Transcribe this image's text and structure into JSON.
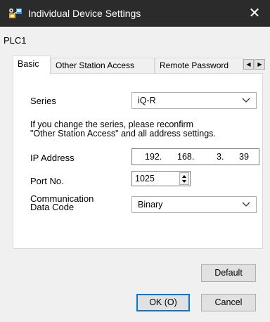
{
  "window": {
    "title": "Individual Device Settings",
    "close_symbol": "✕"
  },
  "device_name": "PLC1",
  "tabs": [
    {
      "label": "Basic",
      "active": true
    },
    {
      "label": "Other Station Access",
      "active": false
    },
    {
      "label": "Remote Password",
      "active": false
    }
  ],
  "tab_scroll": {
    "left": "◀",
    "right": "▶"
  },
  "basic": {
    "series_label": "Series",
    "series_value": "iQ-R",
    "note_line1": "If you change the series, please reconfirm",
    "note_line2": "\"Other Station Access\" and all address settings.",
    "ip_label": "IP Address",
    "ip_octets": [
      "192.",
      "168.",
      "3.",
      "39"
    ],
    "port_label": "Port No.",
    "port_value": "1025",
    "comm_label_line1": "Communication",
    "comm_label_line2": "Data Code",
    "comm_value": "Binary"
  },
  "buttons": {
    "default_label": "Default",
    "ok_label": "OK (O)",
    "cancel_label": "Cancel"
  },
  "colors": {
    "titlebar": "#2b2b2b",
    "focus_border": "#0078d7"
  },
  "icons": {
    "app": "settings-network-icon",
    "close": "close-icon",
    "dropdown": "chevron-down-icon",
    "spinner": "spinner-icon"
  }
}
